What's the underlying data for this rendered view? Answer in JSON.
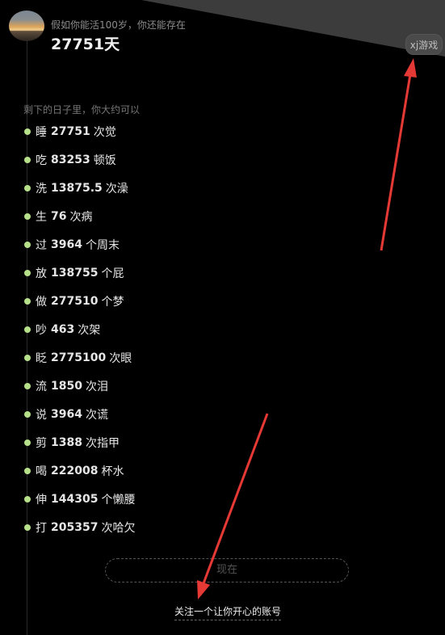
{
  "header": {
    "subtitle": "假如你能活100岁，你还能存在",
    "days_value": "27751",
    "days_unit": "天",
    "game_button": "xj游戏"
  },
  "section": {
    "heading": "剩下的日子里，你大约可以"
  },
  "stats": [
    {
      "verb": "睡",
      "num": "27751",
      "unit": "次觉"
    },
    {
      "verb": "吃",
      "num": "83253",
      "unit": "顿饭"
    },
    {
      "verb": "洗",
      "num": "13875.5",
      "unit": "次澡"
    },
    {
      "verb": "生",
      "num": "76",
      "unit": "次病"
    },
    {
      "verb": "过",
      "num": "3964",
      "unit": "个周末"
    },
    {
      "verb": "放",
      "num": "138755",
      "unit": "个屁"
    },
    {
      "verb": "做",
      "num": "277510",
      "unit": "个梦"
    },
    {
      "verb": "吵",
      "num": "463",
      "unit": "次架"
    },
    {
      "verb": "眨",
      "num": "2775100",
      "unit": "次眼"
    },
    {
      "verb": "流",
      "num": "1850",
      "unit": "次泪"
    },
    {
      "verb": "说",
      "num": "3964",
      "unit": "次谎"
    },
    {
      "verb": "剪",
      "num": "1388",
      "unit": "次指甲"
    },
    {
      "verb": "喝",
      "num": "222008",
      "unit": "杯水"
    },
    {
      "verb": "伸",
      "num": "144305",
      "unit": "个懒腰"
    },
    {
      "verb": "打",
      "num": "205357",
      "unit": "次哈欠"
    }
  ],
  "footer": {
    "now_button": "现在",
    "follow_link": "关注一个让你开心的账号"
  },
  "colors": {
    "background": "#000000",
    "dot_accent": "#b6e089",
    "arrow": "#e53935"
  }
}
